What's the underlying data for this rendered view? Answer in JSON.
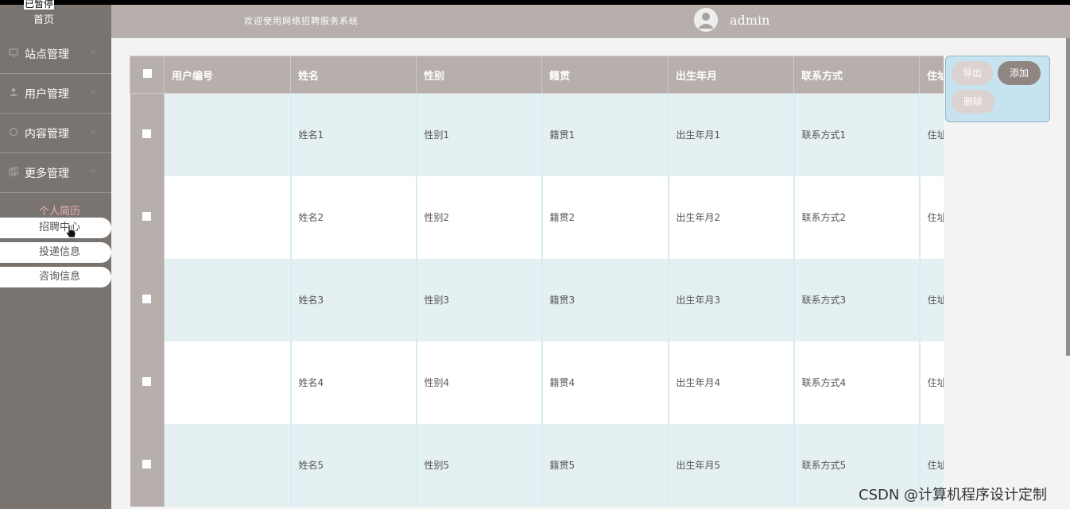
{
  "overlay": {
    "paused_label": "已暂停"
  },
  "sidebar": {
    "home": "首页",
    "menus": [
      {
        "label": "站点管理",
        "icon": "monitor-icon"
      },
      {
        "label": "用户管理",
        "icon": "user-icon"
      },
      {
        "label": "内容管理",
        "icon": "chat-icon"
      },
      {
        "label": "更多管理",
        "icon": "copy-icon"
      }
    ],
    "submenu_title": "个人简历",
    "submenu_items": [
      "招聘中心",
      "投递信息",
      "咨询信息"
    ]
  },
  "header": {
    "welcome": "欢迎使用网络招聘服务系统",
    "username": "admin"
  },
  "table": {
    "columns": [
      "用户编号",
      "姓名",
      "性别",
      "籍贯",
      "出生年月",
      "联系方式",
      "住址"
    ],
    "rows": [
      [
        "",
        "姓名1",
        "性别1",
        "籍贯1",
        "出生年月1",
        "联系方式1",
        "住址"
      ],
      [
        "",
        "姓名2",
        "性别2",
        "籍贯2",
        "出生年月2",
        "联系方式2",
        "住址"
      ],
      [
        "",
        "姓名3",
        "性别3",
        "籍贯3",
        "出生年月3",
        "联系方式3",
        "住址"
      ],
      [
        "",
        "姓名4",
        "性别4",
        "籍贯4",
        "出生年月4",
        "联系方式4",
        "住址"
      ],
      [
        "",
        "姓名5",
        "性别5",
        "籍贯5",
        "出生年月5",
        "联系方式5",
        "住址"
      ]
    ]
  },
  "actions": {
    "export": "导出",
    "add": "添加",
    "delete": "删除"
  },
  "watermark": "CSDN @计算机程序设计定制",
  "colors": {
    "sidebar": "#7a7470",
    "header": "#b6afab",
    "row_alt": "#e4f0f1",
    "accent": "#f0b2ae"
  }
}
